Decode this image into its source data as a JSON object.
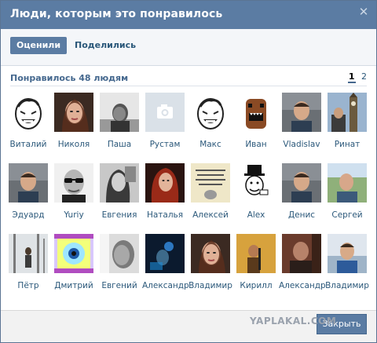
{
  "window": {
    "title": "Люди, которым это понравилось"
  },
  "tabs": [
    {
      "label": "Оценили",
      "active": true
    },
    {
      "label": "Поделились",
      "active": false
    }
  ],
  "summary": {
    "label": "Понравилось 48 людям"
  },
  "pagination": {
    "pages": [
      "1",
      "2"
    ],
    "current": "1"
  },
  "people": [
    {
      "name": "Виталий",
      "avatar": "meme-face"
    },
    {
      "name": "Николя",
      "avatar": "woman-photo"
    },
    {
      "name": "Паша",
      "avatar": "bw-man-photo"
    },
    {
      "name": "Рустам",
      "avatar": "camera-placeholder"
    },
    {
      "name": "Макс",
      "avatar": "meme-face"
    },
    {
      "name": "Иван",
      "avatar": "domo-monster"
    },
    {
      "name": "Vladislav",
      "avatar": "man-photo"
    },
    {
      "name": "Ринат",
      "avatar": "big-ben-photo"
    },
    {
      "name": "Эдуард",
      "avatar": "man-photo"
    },
    {
      "name": "Yuriy",
      "avatar": "sunglasses-man-photo"
    },
    {
      "name": "Евгения",
      "avatar": "bw-woman-photo"
    },
    {
      "name": "Наталья",
      "avatar": "redhead-woman-photo"
    },
    {
      "name": "Алексей",
      "avatar": "text-note"
    },
    {
      "name": "Alex",
      "avatar": "like-a-sir-meme"
    },
    {
      "name": "Денис",
      "avatar": "man-photo"
    },
    {
      "name": "Сергей",
      "avatar": "man-outdoor-photo"
    },
    {
      "name": "Пётр",
      "avatar": "winter-forest-photo"
    },
    {
      "name": "Дмитрий",
      "avatar": "eye-art"
    },
    {
      "name": "Евгений",
      "avatar": "bw-face-photo"
    },
    {
      "name": "Александр",
      "avatar": "dark-blue-photo"
    },
    {
      "name": "Владимир",
      "avatar": "woman-photo"
    },
    {
      "name": "Кирилл",
      "avatar": "guitar-photo"
    },
    {
      "name": "Александр",
      "avatar": "man-dark-photo"
    },
    {
      "name": "Владимир",
      "avatar": "man-blue-shirt-photo"
    }
  ],
  "footer": {
    "close_label": "Закрыть",
    "watermark": "YAPLAKAL.COM"
  }
}
